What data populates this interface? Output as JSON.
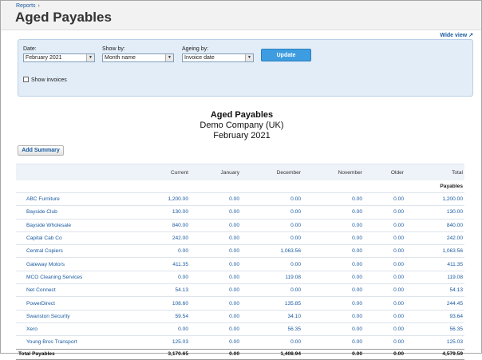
{
  "breadcrumb": {
    "link": "Reports",
    "separator": "›"
  },
  "page_title": "Aged Payables",
  "wide_view": "Wide view ↗",
  "filters": {
    "date_label": "Date:",
    "date_value": "February 2021",
    "show_by_label": "Show by:",
    "show_by_value": "Month name",
    "ageing_by_label": "Ageing by:",
    "ageing_by_value": "Invoice date",
    "update_label": "Update",
    "show_invoices_label": "Show invoices"
  },
  "report": {
    "title": "Aged Payables",
    "company": "Demo Company (UK)",
    "period": "February 2021"
  },
  "add_summary_label": "Add Summary",
  "table": {
    "columns": [
      "",
      "Current",
      "January",
      "December",
      "November",
      "Older",
      "Total"
    ],
    "section_label": "Payables",
    "rows": [
      [
        "ABC Furniture",
        "1,200.00",
        "0.00",
        "0.00",
        "0.00",
        "0.00",
        "1,200.00"
      ],
      [
        "Bayside Club",
        "130.00",
        "0.00",
        "0.00",
        "0.00",
        "0.00",
        "130.00"
      ],
      [
        "Bayside Wholesale",
        "840.00",
        "0.00",
        "0.00",
        "0.00",
        "0.00",
        "840.00"
      ],
      [
        "Capital Cab Co",
        "242.00",
        "0.00",
        "0.00",
        "0.00",
        "0.00",
        "242.00"
      ],
      [
        "Central Copiers",
        "0.00",
        "0.00",
        "1,063.56",
        "0.00",
        "0.00",
        "1,063.56"
      ],
      [
        "Gateway Motors",
        "411.35",
        "0.00",
        "0.00",
        "0.00",
        "0.00",
        "411.35"
      ],
      [
        "MCO Cleaning Services",
        "0.00",
        "0.00",
        "119.08",
        "0.00",
        "0.00",
        "119.08"
      ],
      [
        "Net Connect",
        "54.13",
        "0.00",
        "0.00",
        "0.00",
        "0.00",
        "54.13"
      ],
      [
        "PowerDirect",
        "108.60",
        "0.00",
        "135.85",
        "0.00",
        "0.00",
        "244.45"
      ],
      [
        "Swanston Security",
        "59.54",
        "0.00",
        "34.10",
        "0.00",
        "0.00",
        "93.64"
      ],
      [
        "Xero",
        "0.00",
        "0.00",
        "56.35",
        "0.00",
        "0.00",
        "56.35"
      ],
      [
        "Young Bros Transport",
        "125.03",
        "0.00",
        "0.00",
        "0.00",
        "0.00",
        "125.03"
      ]
    ],
    "total": [
      "Total Payables",
      "3,170.65",
      "0.00",
      "1,408.94",
      "0.00",
      "0.00",
      "4,579.59"
    ]
  }
}
